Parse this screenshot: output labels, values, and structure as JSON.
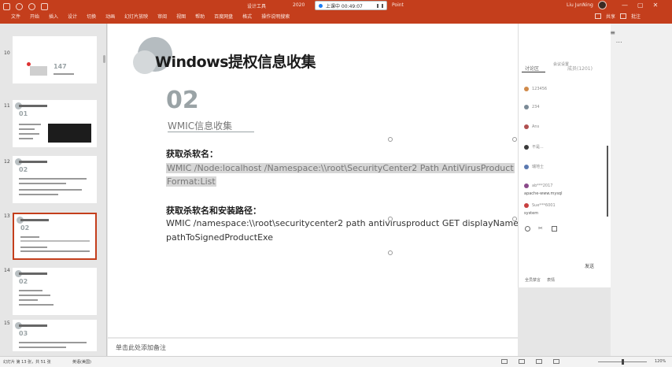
{
  "titlebar": {
    "title_left": "设计工具",
    "title_mid": "2020",
    "recording": "上课中 00:49:07",
    "title_right": "Point",
    "user": "Liu JunNing",
    "win_buttons": [
      "—",
      "▢",
      "✕"
    ]
  },
  "ribbon_tabs": [
    "文件",
    "开始",
    "插入",
    "设计",
    "切换",
    "动画",
    "幻灯片放映",
    "审阅",
    "视图",
    "帮助",
    "百度网盘",
    "格式",
    "操作说明搜索"
  ],
  "ribbon_right": [
    "共享",
    "批注"
  ],
  "thumbnails": [
    {
      "num": "10",
      "label": "147"
    },
    {
      "num": "11",
      "label": "01"
    },
    {
      "num": "12",
      "label": "02"
    },
    {
      "num": "13",
      "label": "02"
    },
    {
      "num": "14",
      "label": "02"
    },
    {
      "num": "15",
      "label": "03"
    }
  ],
  "slide": {
    "title": "Windows提权信息收集",
    "number": "02",
    "subtitle": "WMIC信息收集",
    "label1": "获取杀软名：",
    "code_line1": "WMIC /Node:localhost /Namespace:\\\\root\\SecurityCenter2 Path AntiVirusProduct",
    "code_line2": "Format:List",
    "label2": "获取杀软名和安装路径：",
    "cmd_line1": "WMIC /namespace:\\\\root\\securitycenter2 path antivirusproduct GET displayName,",
    "cmd_line2": "pathToSignedProductExe"
  },
  "notes_placeholder": "单击此处添加备注",
  "chat": {
    "top": "会议设置",
    "tab_discuss": "讨论区",
    "tab_members": "成员(1201)",
    "messages": [
      {
        "name": "123456",
        "color": "#d08a4a"
      },
      {
        "name": "234",
        "color": "#7b8a96"
      },
      {
        "name": "Ans",
        "color": "#b05050"
      },
      {
        "name": "不是...",
        "color": "#3a3a3a"
      },
      {
        "name": "瑞地士",
        "color": "#5b79b0"
      },
      {
        "name": "ab***2017",
        "color": "#8a4a8a",
        "text": "apache-www.mysql"
      },
      {
        "name": "Sue***6001",
        "color": "#c84040",
        "text": "system"
      }
    ],
    "send_label": "发送",
    "foot": [
      "全员禁言",
      "表情"
    ]
  },
  "status": {
    "slide_info": "幻灯片 第 13 张，共 51 张",
    "language": "英语(美国)",
    "zoom": "120%"
  }
}
